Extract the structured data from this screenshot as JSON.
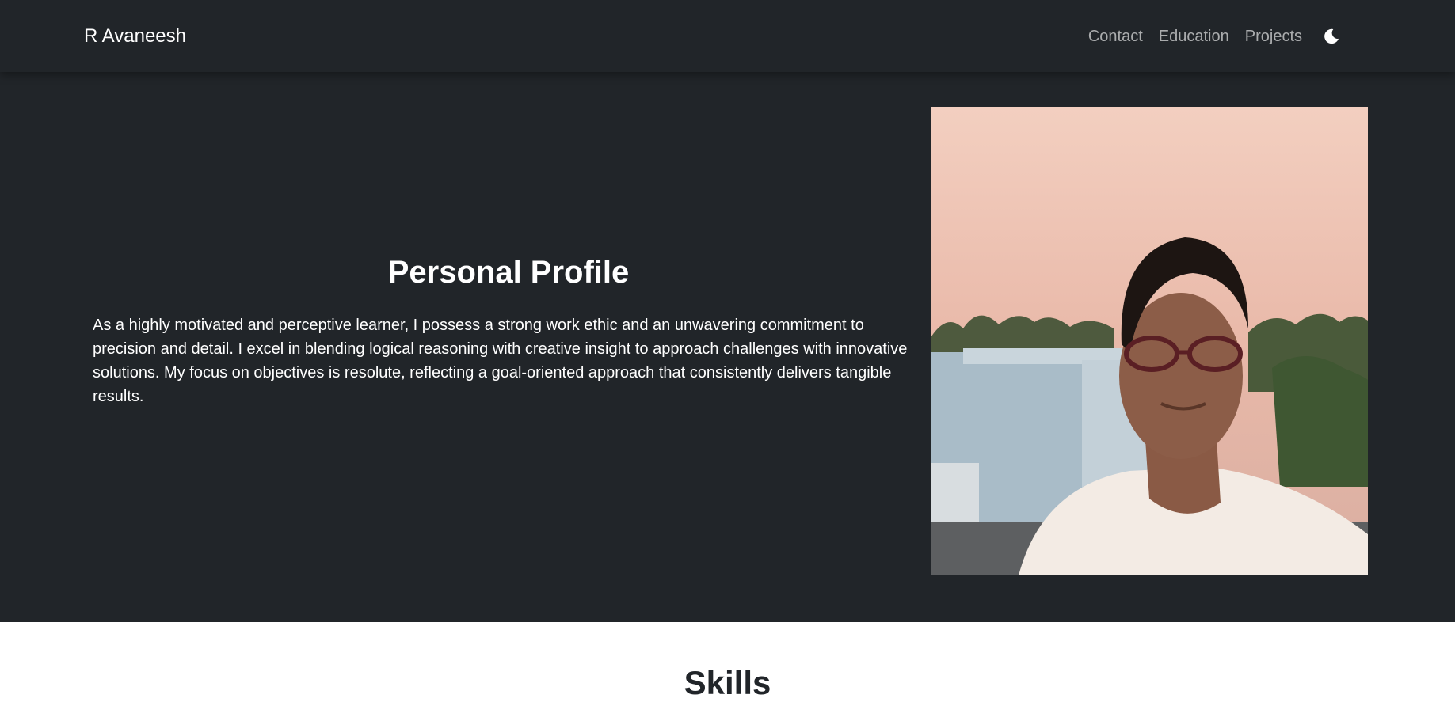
{
  "navbar": {
    "brand": "R Avaneesh",
    "links": [
      "Contact",
      "Education",
      "Projects"
    ],
    "theme_toggle_icon": "moon-icon"
  },
  "profile": {
    "title": "Personal Profile",
    "description": "As a highly motivated and perceptive learner, I possess a strong work ethic and an unwavering commitment to precision and detail. I excel in blending logical reasoning with creative insight to approach challenges with innovative solutions. My focus on objectives is resolute, reflecting a goal-oriented approach that consistently delivers tangible results.",
    "photo_icon": "profile-photo"
  },
  "skills": {
    "title": "Skills"
  },
  "colors": {
    "dark_bg": "#212529",
    "light_bg": "#ffffff",
    "nav_link": "rgba(255,255,255,0.62)"
  }
}
